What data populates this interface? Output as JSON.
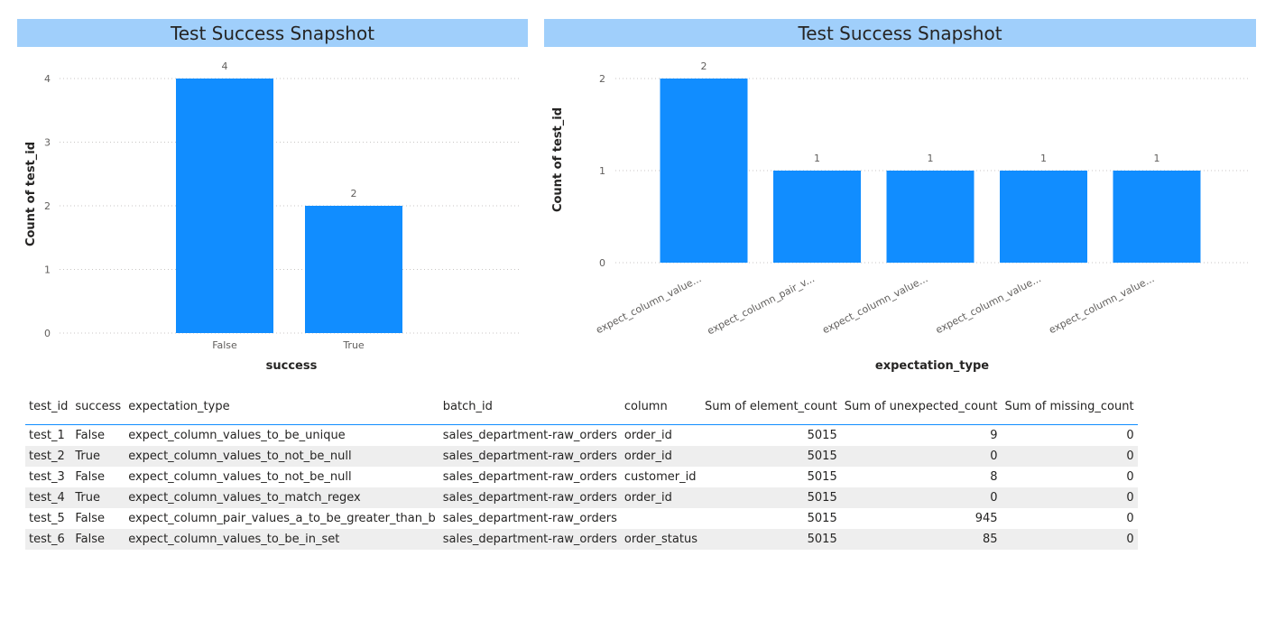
{
  "colors": {
    "bar": "#118dff",
    "title_bg": "#a0cffb",
    "grid": "#c8c6c4"
  },
  "chart_data": [
    {
      "type": "bar",
      "title": "Test Success Snapshot",
      "xlabel": "success",
      "ylabel": "Count of test_id",
      "categories": [
        "False",
        "True"
      ],
      "values": [
        4,
        2
      ],
      "ylim": [
        0,
        4
      ],
      "yticks": [
        "0",
        "1",
        "2",
        "3",
        "4"
      ],
      "data_labels": [
        "4",
        "2"
      ],
      "grid": true
    },
    {
      "type": "bar",
      "title": "Test Success Snapshot",
      "xlabel": "expectation_type",
      "ylabel": "Count of test_id",
      "categories": [
        "expect_column_value...",
        "expect_column_pair_v...",
        "expect_column_value...",
        "expect_column_value...",
        "expect_column_value..."
      ],
      "values": [
        2,
        1,
        1,
        1,
        1
      ],
      "ylim": [
        0,
        2
      ],
      "yticks": [
        "0",
        "1",
        "2"
      ],
      "data_labels": [
        "2",
        "1",
        "1",
        "1",
        "1"
      ],
      "grid": true
    }
  ],
  "table": {
    "headers": [
      "test_id",
      "success",
      "expectation_type",
      "batch_id",
      "column",
      "Sum of element_count",
      "Sum of unexpected_count",
      "Sum of missing_count"
    ],
    "rows": [
      [
        "test_1",
        "False",
        "expect_column_values_to_be_unique",
        "sales_department-raw_orders",
        "order_id",
        "5015",
        "9",
        "0"
      ],
      [
        "test_2",
        "True",
        "expect_column_values_to_not_be_null",
        "sales_department-raw_orders",
        "order_id",
        "5015",
        "0",
        "0"
      ],
      [
        "test_3",
        "False",
        "expect_column_values_to_not_be_null",
        "sales_department-raw_orders",
        "customer_id",
        "5015",
        "8",
        "0"
      ],
      [
        "test_4",
        "True",
        "expect_column_values_to_match_regex",
        "sales_department-raw_orders",
        "order_id",
        "5015",
        "0",
        "0"
      ],
      [
        "test_5",
        "False",
        "expect_column_pair_values_a_to_be_greater_than_b",
        "sales_department-raw_orders",
        "",
        "5015",
        "945",
        "0"
      ],
      [
        "test_6",
        "False",
        "expect_column_values_to_be_in_set",
        "sales_department-raw_orders",
        "order_status",
        "5015",
        "85",
        "0"
      ]
    ]
  }
}
